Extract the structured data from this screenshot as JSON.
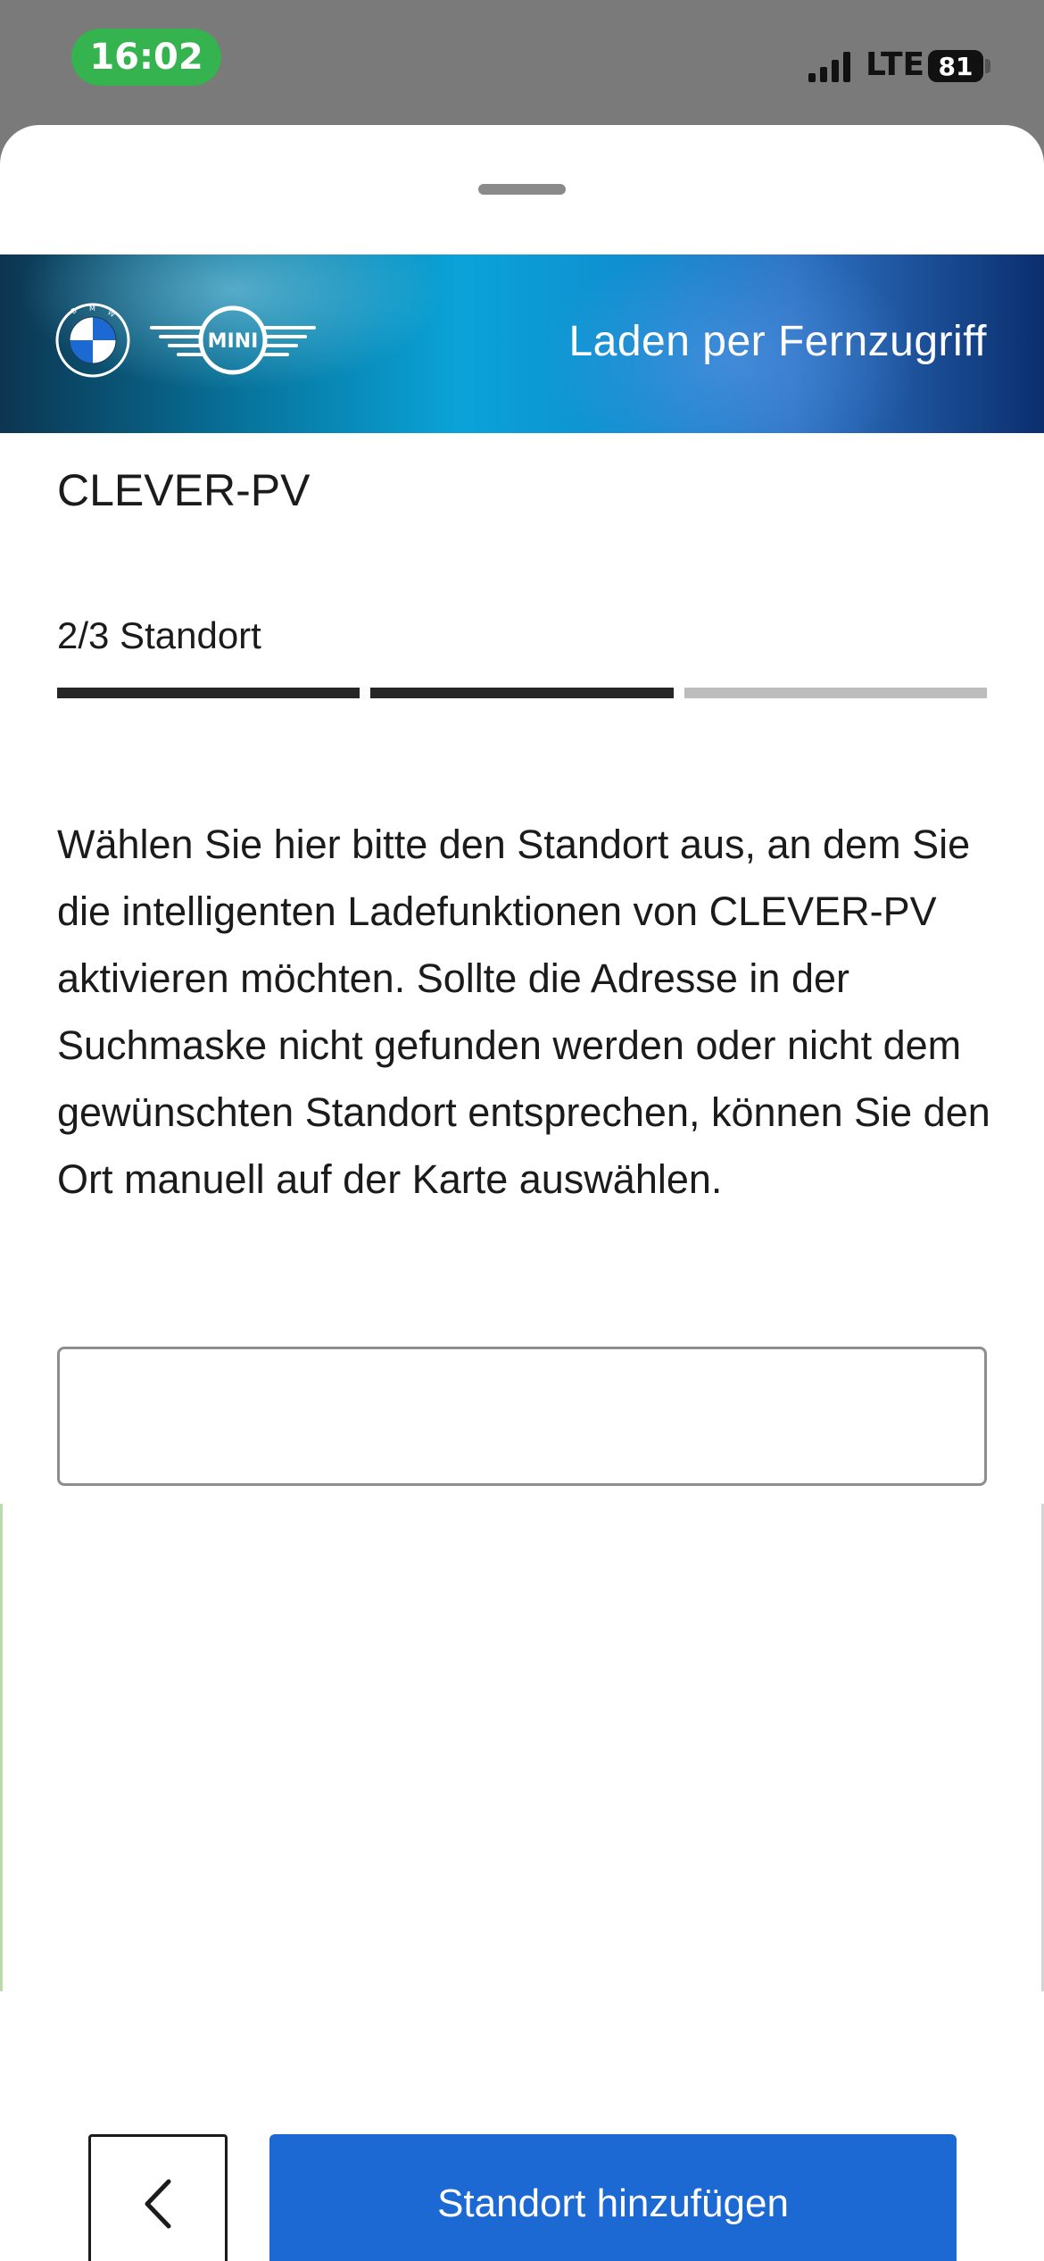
{
  "status_bar": {
    "time": "16:02",
    "network": "LTE",
    "battery": "81",
    "icons": {
      "signal": "signal-bars-icon"
    }
  },
  "header": {
    "title": "Laden per Fernzugriff",
    "logos": [
      "bmw-logo",
      "mini-logo"
    ],
    "mini_wordmark": "MINI"
  },
  "service": {
    "name": "CLEVER-PV"
  },
  "step": {
    "label": "2/3 Standort",
    "current": 2,
    "total": 3
  },
  "instructions": "Wählen Sie hier bitte den Standort aus, an dem Sie die intelligenten Ladefunktionen von CLEVER-PV aktivieren möchten. Sollte die Adresse in der Suchmaske nicht gefunden werden oder nicht dem gewünschten Standort entsprechen, können Sie den Ort manuell auf der Karte auswählen.",
  "search": {
    "value": "",
    "placeholder": ""
  },
  "actions": {
    "back_icon": "chevron-left-icon",
    "primary_label": "Standort hinzufügen"
  },
  "colors": {
    "primary": "#1c69d3",
    "time_pill": "#34b34f",
    "progress_done": "#262626",
    "progress_todo": "#bdbdbd"
  }
}
